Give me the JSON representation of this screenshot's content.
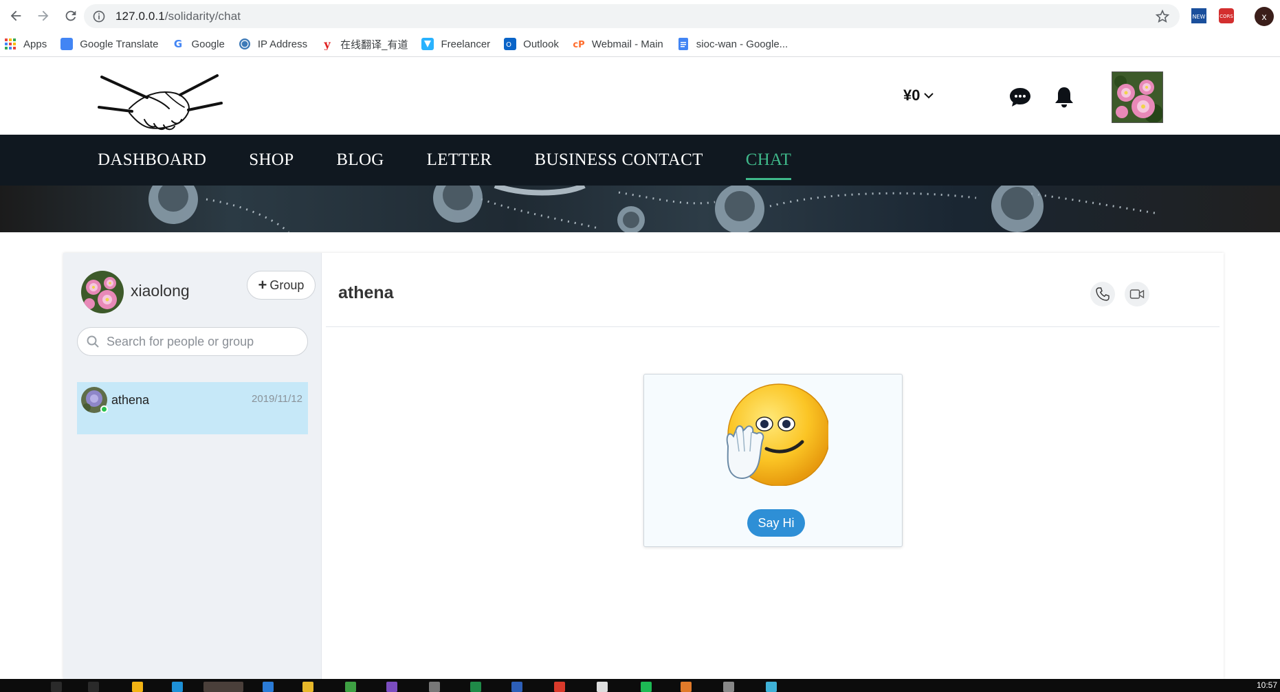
{
  "browser": {
    "url_host": "127.0.0.1",
    "url_path": "/solidarity/chat",
    "profile_initial": "x",
    "bookmarks": [
      {
        "label": "Apps",
        "icon": "apps-grid-icon"
      },
      {
        "label": "Google Translate",
        "icon": "google-translate-icon"
      },
      {
        "label": "Google",
        "icon": "google-icon"
      },
      {
        "label": "IP Address",
        "icon": "globe-icon"
      },
      {
        "label": "在线翻译_有道",
        "icon": "youdao-icon"
      },
      {
        "label": "Freelancer",
        "icon": "freelancer-icon"
      },
      {
        "label": "Outlook",
        "icon": "outlook-icon"
      },
      {
        "label": "Webmail - Main",
        "icon": "cpanel-icon"
      },
      {
        "label": "sioc-wan - Google...",
        "icon": "google-docs-icon"
      }
    ]
  },
  "header": {
    "balance": "¥0",
    "nav": [
      {
        "label": "DASHBOARD",
        "active": false
      },
      {
        "label": "SHOP",
        "active": false
      },
      {
        "label": "BLOG",
        "active": false
      },
      {
        "label": "LETTER",
        "active": false
      },
      {
        "label": "BUSINESS CONTACT",
        "active": false
      },
      {
        "label": "CHAT",
        "active": true
      }
    ]
  },
  "sidebar": {
    "user_name": "xiaolong",
    "group_label": "Group",
    "search_placeholder": "Search for people or group",
    "contacts": [
      {
        "name": "athena",
        "date": "2019/11/12",
        "online": true
      }
    ]
  },
  "conversation": {
    "title": "athena",
    "say_hi_label": "Say Hi"
  },
  "taskbar": {
    "clock": "10:57"
  },
  "colors": {
    "nav_bg": "#101820",
    "accent_active": "#3fb88a",
    "contact_selected_bg": "#c6e8f8",
    "say_hi_button": "#2e8fd6"
  }
}
